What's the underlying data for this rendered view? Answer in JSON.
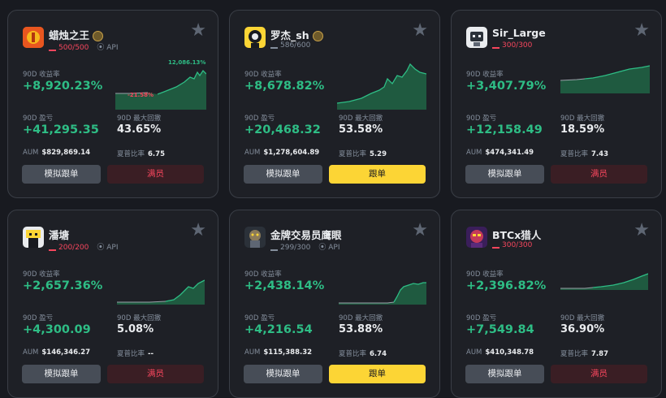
{
  "labels": {
    "roi": "90D 收益率",
    "pnl": "90D 盈亏",
    "mdd": "90D 最大回撤",
    "aum": "AUM",
    "sharpe": "夏普比率",
    "sim_button": "模拟跟单",
    "full_button": "满员",
    "copy_button": "跟单",
    "api": "API"
  },
  "colors": {
    "positive": "#2ebd85",
    "negative": "#f6465d",
    "accent": "#fcd535"
  },
  "cards": [
    {
      "name": "蜡烛之王",
      "count": "500/500",
      "full": true,
      "api": true,
      "roi": "+8,920.23%",
      "pnl": "+41,295.35",
      "mdd": "43.65%",
      "aum": "$829,869.14",
      "sharpe": "6.75",
      "chart_max": "12,086.13%",
      "chart_min": "-21.58%",
      "icon": "candle-king-avatar"
    },
    {
      "name": "罗杰_sh",
      "count": "586/600",
      "full": false,
      "api": false,
      "roi": "+8,678.82%",
      "pnl": "+20,468.32",
      "mdd": "53.58%",
      "aum": "$1,278,604.89",
      "sharpe": "5.29",
      "icon": "astronaut-avatar"
    },
    {
      "name": "Sir_Large",
      "count": "300/300",
      "full": true,
      "api": false,
      "roi": "+3,407.79%",
      "pnl": "+12,158.49",
      "mdd": "18.59%",
      "aum": "$474,341.49",
      "sharpe": "7.43",
      "icon": "robot-avatar"
    },
    {
      "name": "潘塘",
      "count": "200/200",
      "full": true,
      "api": true,
      "roi": "+2,657.36%",
      "pnl": "+4,300.09",
      "mdd": "5.08%",
      "aum": "$146,346.27",
      "sharpe": "--",
      "icon": "yellow-face-avatar"
    },
    {
      "name": "金牌交易员鹰眼",
      "count": "299/300",
      "full": false,
      "api": true,
      "roi": "+2,438.14%",
      "pnl": "+4,216.54",
      "mdd": "53.88%",
      "aum": "$115,388.32",
      "sharpe": "6.74",
      "icon": "hawk-avatar"
    },
    {
      "name": "BTCx猎人",
      "count": "300/300",
      "full": true,
      "api": false,
      "roi": "+2,396.82%",
      "pnl": "+7,549.84",
      "mdd": "36.90%",
      "aum": "$410,348.78",
      "sharpe": "7.87",
      "icon": "hunter-avatar"
    }
  ]
}
